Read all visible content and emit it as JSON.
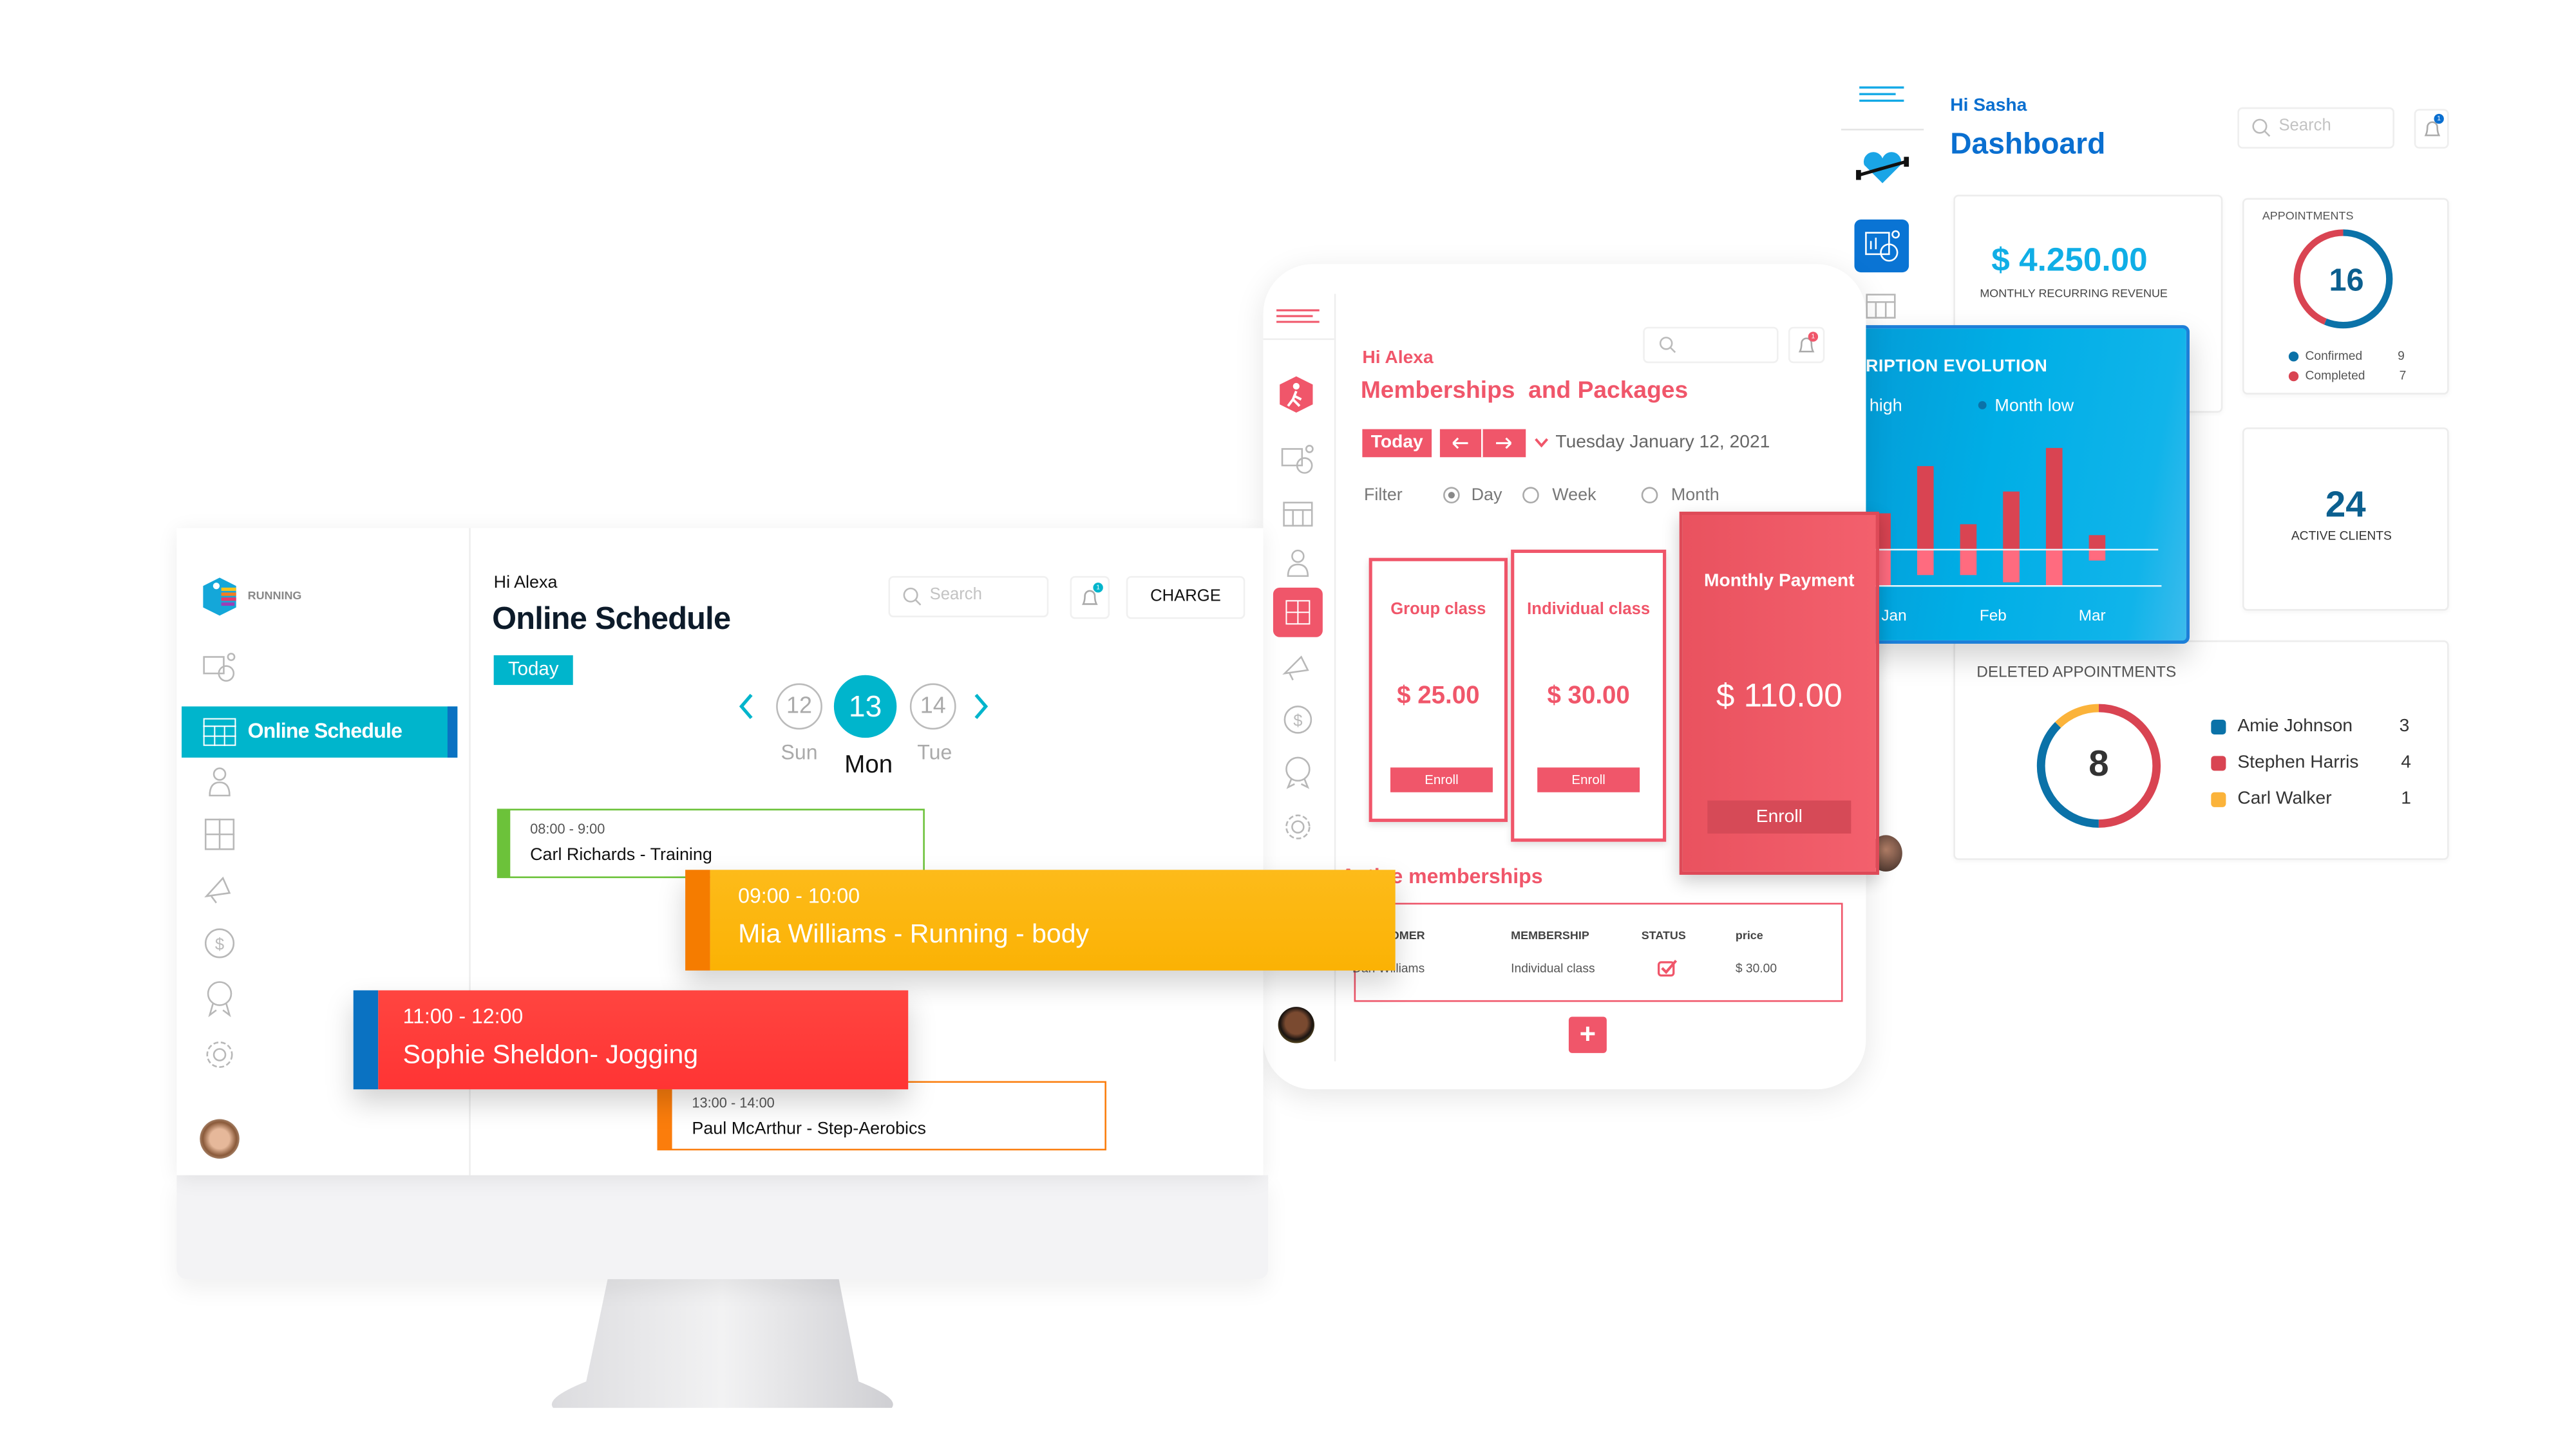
{
  "dashboard": {
    "greeting": "Hi Sasha",
    "title": "Dashboard",
    "search_placeholder": "Search",
    "notification_count": "1",
    "revenue": {
      "value": "$ 4.250.00",
      "label": "MONTHLY RECURRING REVENUE"
    },
    "appointments": {
      "title": "APPOINTMENTS",
      "total": "16",
      "legend": [
        {
          "label": "Confirmed",
          "value": "9"
        },
        {
          "label": "Completed",
          "value": "7"
        }
      ]
    },
    "active_clients": {
      "value": "24",
      "label": "ACTIVE CLIENTS"
    },
    "subscription": {
      "title": "SUBSCRIPTION EVOLUTION",
      "legend_high": "Month high",
      "legend_low": "Month low"
    },
    "deleted": {
      "title": "DELETED APPOINTMENTS",
      "total": "8",
      "legend": [
        {
          "label": "Amie Johnson",
          "value": "3"
        },
        {
          "label": "Stephen Harris",
          "value": "4"
        },
        {
          "label": "Carl Walker",
          "value": "1"
        }
      ]
    },
    "sidebar_icons": [
      "menu-icon",
      "heart-dumbbell-logo",
      "analytics-icon",
      "calendar-icon"
    ]
  },
  "memberships": {
    "greeting": "Hi Alexa",
    "title": "Memberships  and Packages",
    "notification_count": "1",
    "today_label": "Today",
    "prev_icon": "arrow-left-icon",
    "next_icon": "arrow-right-icon",
    "date": "Tuesday January 12, 2021",
    "filter_label": "Filter",
    "filters": [
      {
        "label": "Day",
        "selected": true
      },
      {
        "label": "Week",
        "selected": false
      },
      {
        "label": "Month",
        "selected": false
      }
    ],
    "packages": [
      {
        "name": "Group class",
        "price": "$ 25.00",
        "button": "Enroll"
      },
      {
        "name": "Individual class",
        "price": "$ 30.00",
        "button": "Enroll"
      },
      {
        "name": "Monthly Payment",
        "price": "$ 110.00",
        "button": "Enroll"
      }
    ],
    "active_title": "Active memberships",
    "table": {
      "headers": [
        "CUSTOMER",
        "MEMBERSHIP",
        "STATUS",
        "price"
      ],
      "rows": [
        {
          "customer": "Dan Williams",
          "membership": "Individual class",
          "status": "checked",
          "price": "$ 30.00"
        }
      ]
    },
    "add_label": "+"
  },
  "schedule": {
    "brand": "RUNNING",
    "active_nav": "Online Schedule",
    "greeting": "Hi Alexa",
    "title": "Online Schedule",
    "search_placeholder": "Search",
    "notification_count": "1",
    "charge_label": "CHARGE",
    "today_label": "Today",
    "days": [
      {
        "num": "12",
        "name": "Sun"
      },
      {
        "num": "13",
        "name": "Mon",
        "selected": true
      },
      {
        "num": "14",
        "name": "Tue"
      }
    ],
    "events": [
      {
        "time": "08:00 - 9:00",
        "title": "Carl Richards - Training",
        "color": "#6cc23a"
      },
      {
        "time": "09:00 - 10:00",
        "title": "Mia Williams - Running - body",
        "color": "#fdb813"
      },
      {
        "time": "11:00 - 12:00",
        "title": "Sophie Sheldon- Jogging",
        "color": "#ff3b3b"
      },
      {
        "time": "13:00 - 14:00",
        "title": "Paul McArthur - Step-Aerobics",
        "color": "#fb7d0c"
      }
    ]
  },
  "colors": {
    "teal": "#00b5cc",
    "coral": "#f0566a",
    "blue": "#0b72a8",
    "red": "#d94452",
    "yellow": "#fbb33a"
  },
  "chart_data": [
    {
      "type": "bar",
      "title": "SUBSCRIPTION EVOLUTION",
      "x_labels": [
        "Jan",
        "Feb",
        "Mar"
      ],
      "series": [
        {
          "name": "Month high",
          "values": [
            10,
            23,
            7,
            16,
            28,
            4
          ]
        },
        {
          "name": "Month low",
          "values": [
            10,
            7,
            7,
            9,
            10,
            3
          ]
        }
      ],
      "grid": false,
      "legend": "top-left"
    },
    {
      "type": "pie",
      "title": "APPOINTMENTS",
      "center_label": "16",
      "categories": [
        "Confirmed",
        "Completed"
      ],
      "values": [
        9,
        7
      ],
      "colors": [
        "#0b72a8",
        "#d94452"
      ]
    },
    {
      "type": "pie",
      "title": "DELETED APPOINTMENTS",
      "center_label": "8",
      "categories": [
        "Stephen Harris",
        "Amie Johnson",
        "Carl Walker"
      ],
      "values": [
        4,
        3,
        1
      ],
      "colors": [
        "#d94452",
        "#0b72a8",
        "#fbb33a"
      ]
    }
  ]
}
